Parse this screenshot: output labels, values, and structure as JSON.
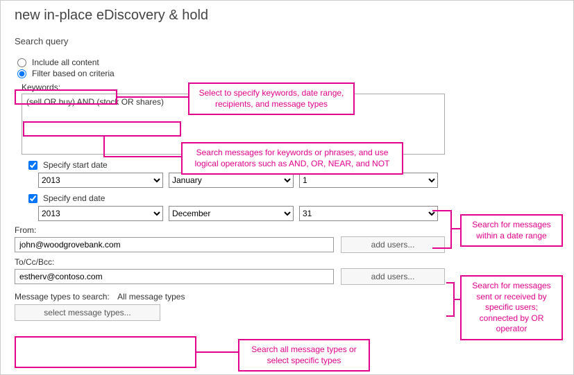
{
  "header": {
    "title": "new in-place eDiscovery & hold",
    "section": "Search query"
  },
  "radios": {
    "include_all": "Include all content",
    "filter_criteria": "Filter based on criteria"
  },
  "keywords": {
    "label": "Keywords:",
    "value": "(sell OR buy) AND (stock OR shares)"
  },
  "dates": {
    "start_label": "Specify start date",
    "end_label": "Specify end date",
    "start_year": "2013",
    "start_month": "January",
    "start_day": "1",
    "end_year": "2013",
    "end_month": "December",
    "end_day": "31"
  },
  "from": {
    "label": "From:",
    "value": "john@woodgrovebank.com",
    "button": "add users..."
  },
  "to": {
    "label": "To/Cc/Bcc:",
    "value": "estherv@contoso.com",
    "button": "add users..."
  },
  "msg_types": {
    "label": "Message types to search:",
    "value": "All message types",
    "button": "select message types..."
  },
  "callouts": {
    "c1": "Select to specify keywords, date range, recipients, and message types",
    "c2": "Search messages for keywords or phrases, and use logical operators such as AND, OR, NEAR, and NOT",
    "c3": "Search for messages within a date range",
    "c4": "Search for messages sent or received by specific users; connected by OR operator",
    "c5": "Search all message types or select specific types"
  },
  "colors": {
    "accent": "#e3008c"
  }
}
